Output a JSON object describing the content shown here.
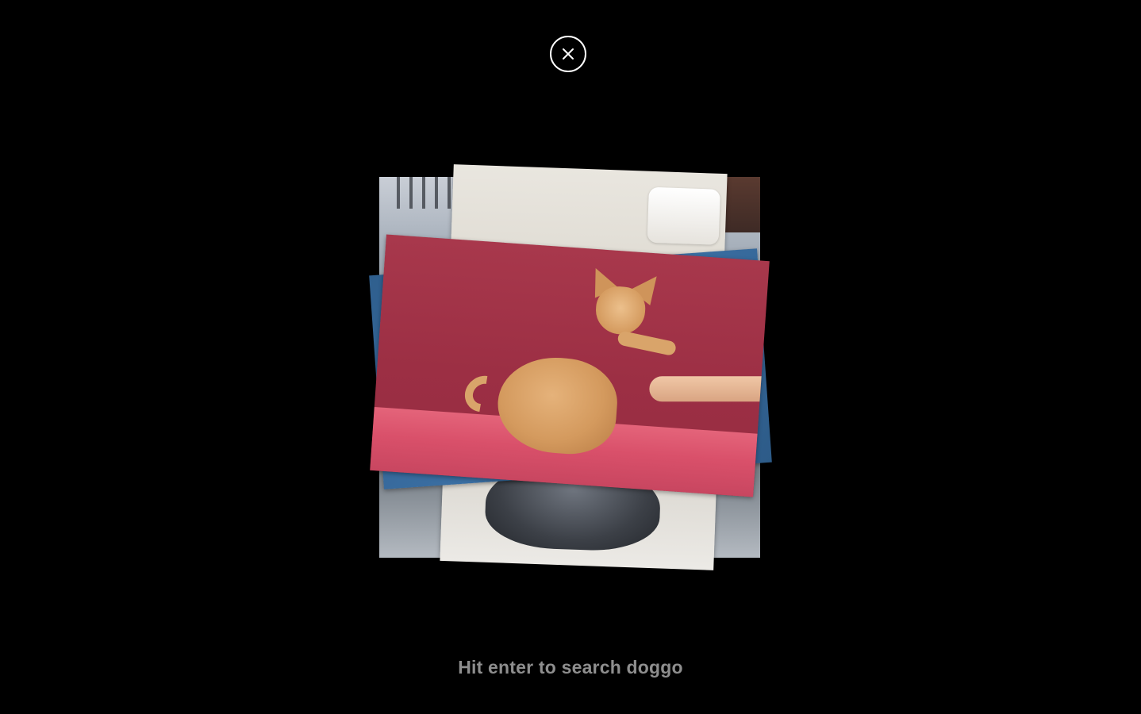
{
  "close_button": {
    "icon": "close-icon",
    "color": "#ffffff"
  },
  "photos": [
    {
      "name": "snowy-street-photo",
      "accent": "#a7b0bb"
    },
    {
      "name": "towel-dog-photo",
      "accent": "#e9e6df"
    },
    {
      "name": "blue-photo",
      "accent": "#3b6fa3"
    },
    {
      "name": "chihuahua-photo",
      "accent": "#9c2f44"
    }
  ],
  "hint": {
    "text": "Hit enter to search doggo",
    "color": "#8e8e8e"
  },
  "colors": {
    "background": "#000000"
  }
}
